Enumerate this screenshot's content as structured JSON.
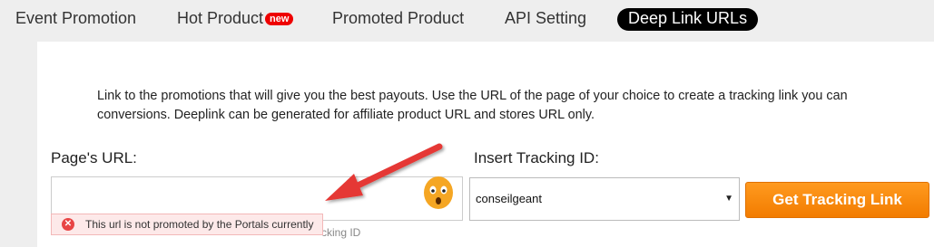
{
  "tabs": [
    {
      "label": "Event Promotion"
    },
    {
      "label": "Hot Product",
      "badge": "new"
    },
    {
      "label": "Promoted Product"
    },
    {
      "label": "API Setting"
    },
    {
      "label": "Deep Link URLs",
      "active": true
    }
  ],
  "intro": "Link to the promotions that will give you the best payouts. Use the URL of the page of your choice to create a tracking link you can\nconversions. Deeplink can be generated for affiliate product URL and stores URL only.",
  "url_field": {
    "label": "Page's URL:",
    "value": "",
    "error": "This url is not promoted by the Portals currently",
    "hint_fragment": "cking ID"
  },
  "tracking_field": {
    "label": "Insert Tracking ID:",
    "selected": "conseilgeant"
  },
  "button": {
    "label": "Get Tracking Link"
  },
  "colors": {
    "accent": "#f7870f",
    "error": "#e84545",
    "arrow": "#e53935",
    "emoji": "#f5a623"
  }
}
